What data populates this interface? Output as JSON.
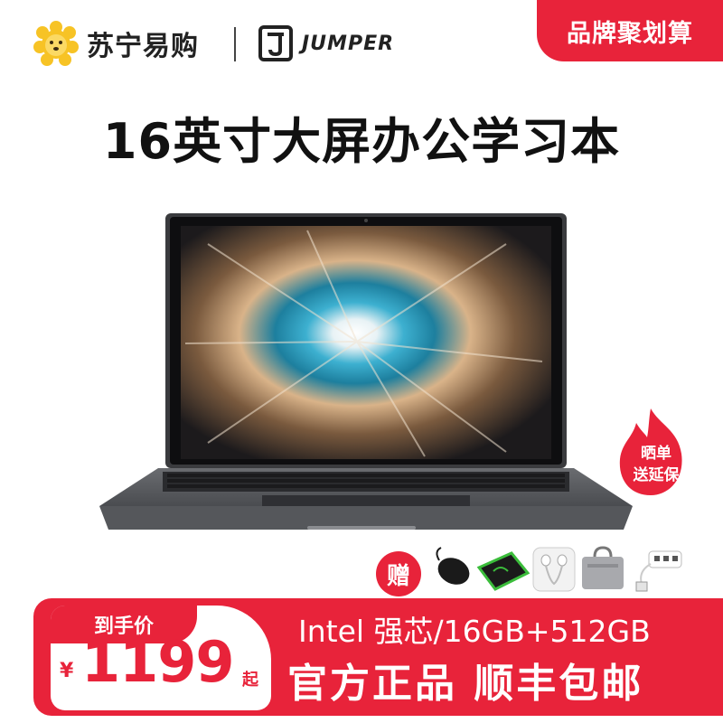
{
  "brand": {
    "store_name": "苏宁易购",
    "partner_name": "JUMPER",
    "store_logo_icon": "lion-face-icon",
    "partner_logo_icon": "jumper-j-mark-icon"
  },
  "promo_tag": "品牌聚划算",
  "headline": "16英寸大屏办公学习本",
  "badge": {
    "line1": "晒单",
    "line2": "送延保",
    "icon": "flame-icon"
  },
  "gift": {
    "label": "赠",
    "items": [
      "mouse-icon",
      "mousepad-icon",
      "earphones-icon",
      "laptop-bag-icon",
      "usb-hub-icon"
    ]
  },
  "price_block": {
    "label": "到手价",
    "currency": "¥",
    "price": "1199",
    "suffix": "起"
  },
  "specs": "Intel 强芯/16GB+512GB",
  "guarantee": "官方正品 顺丰包邮",
  "colors": {
    "accent_red": "#e8233a",
    "store_yellow": "#f7c325",
    "laptop_gray": "#5d5f63"
  }
}
